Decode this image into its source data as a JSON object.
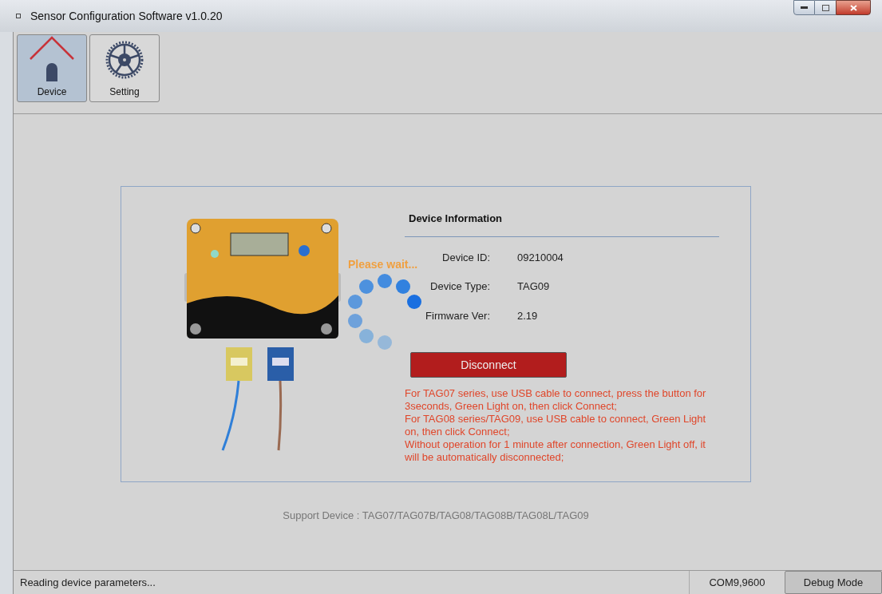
{
  "window": {
    "title": "Sensor Configuration Software v1.0.20"
  },
  "toolbar": [
    {
      "label": "Device",
      "kind": "device",
      "selected": true
    },
    {
      "label": "Setting",
      "kind": "setting",
      "selected": false
    }
  ],
  "device_info": {
    "heading": "Device Information",
    "fields": [
      {
        "label": "Device ID:",
        "value": "09210004"
      },
      {
        "label": "Device Type:",
        "value": "TAG09"
      },
      {
        "label": "Firmware Ver:",
        "value": "2.19"
      }
    ],
    "button": "Disconnect",
    "notes": [
      "For TAG07 series, use USB cable to connect, press the button for  3seconds, Green Light on, then click Connect;",
      "For TAG08 series/TAG09, use USB cable to connect, Green Light on, then click Connect;",
      "Without operation for 1 minute after connection, Green Light off, it will be automatically disconnected;"
    ]
  },
  "loading": {
    "text": "Please wait..."
  },
  "support": "Support Device : TAG07/TAG07B/TAG08/TAG08B/TAG08L/TAG09",
  "status_bar": {
    "message": "Reading device parameters...",
    "port": "COM9,9600",
    "button": "Debug Mode"
  }
}
